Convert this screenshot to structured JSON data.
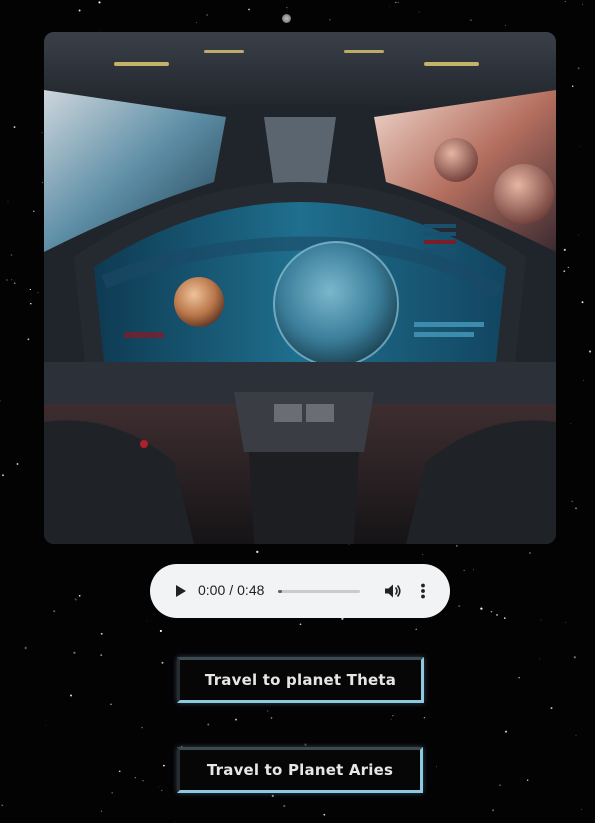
{
  "scene": {
    "image_subject": "spaceship-cockpit-view-of-planets"
  },
  "audio_player": {
    "current_time": "0:00",
    "separator": "/",
    "duration": "0:48",
    "progress": 0.05,
    "icons": {
      "play": "play-icon",
      "volume": "volume-icon",
      "more": "more-vert-icon"
    }
  },
  "buttons": {
    "theta_label": "Travel to planet Theta",
    "aries_label": "Travel to Planet Aries"
  },
  "colors": {
    "background": "#030304",
    "player_bg": "#f1f3f4",
    "button_border_accent": "#8ec9e2",
    "button_text": "#e6e6e6"
  }
}
